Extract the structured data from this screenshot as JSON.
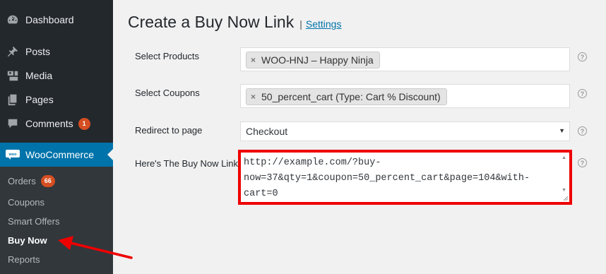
{
  "sidebar": {
    "items": [
      {
        "label": "Dashboard",
        "icon": "dashboard-icon"
      },
      {
        "label": "Posts",
        "icon": "pin-icon"
      },
      {
        "label": "Media",
        "icon": "media-icon"
      },
      {
        "label": "Pages",
        "icon": "pages-icon"
      },
      {
        "label": "Comments",
        "icon": "comment-icon",
        "badge": "1"
      },
      {
        "label": "WooCommerce",
        "icon": "woo-icon"
      }
    ],
    "submenu": [
      {
        "label": "Orders",
        "badge": "66"
      },
      {
        "label": "Coupons"
      },
      {
        "label": "Smart Offers"
      },
      {
        "label": "Buy Now"
      },
      {
        "label": "Reports"
      }
    ]
  },
  "page": {
    "title": "Create a Buy Now Link",
    "separator": "|",
    "settings_link": "Settings"
  },
  "form": {
    "products_label": "Select Products",
    "products_value": "WOO-HNJ – Happy Ninja",
    "coupons_label": "Select Coupons",
    "coupons_value": "50_percent_cart (Type: Cart % Discount)",
    "redirect_label": "Redirect to page",
    "redirect_value": "Checkout",
    "link_label": "Here's The Buy Now Link",
    "link_value": "http://example.com/?buy-\nnow=37&qty=1&coupon=50_percent_cart&page=104&with-\ncart=0",
    "help_glyph": "?",
    "remove_glyph": "×"
  },
  "colors": {
    "sidebar_bg": "#23282d",
    "submenu_bg": "#32373c",
    "active_bg": "#0073aa",
    "badge": "#d54e21",
    "highlight": "#e00000"
  }
}
